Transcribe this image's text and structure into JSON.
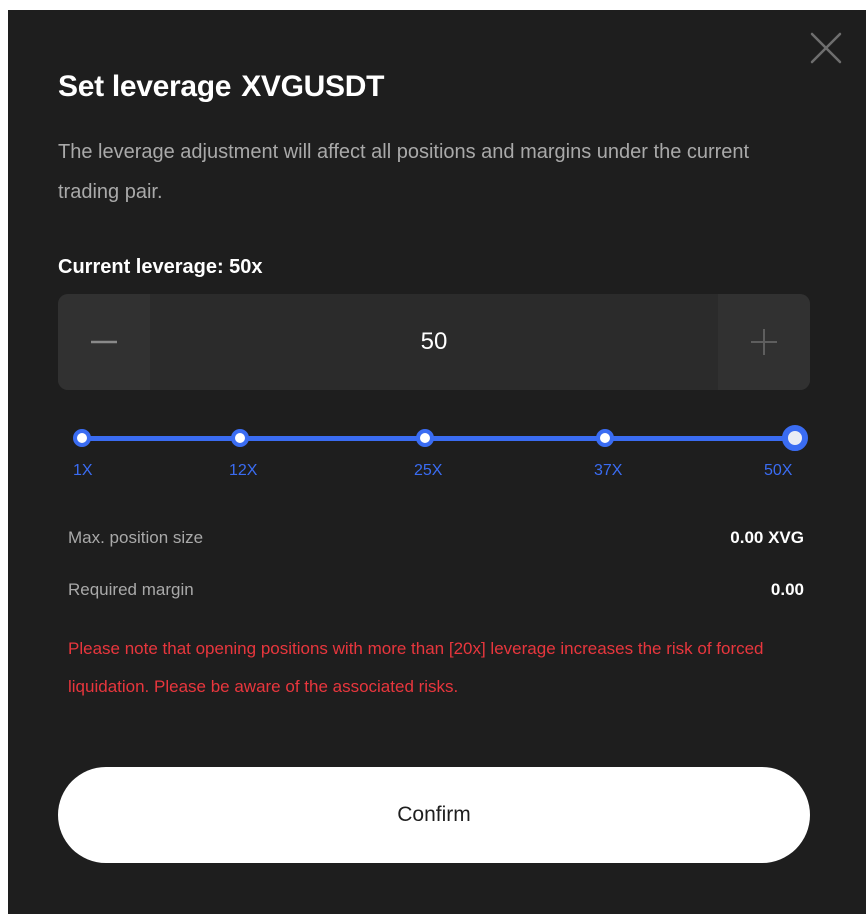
{
  "dialog": {
    "title": "Set leverage",
    "pair": "XVGUSDT",
    "description": "The leverage adjustment will affect all positions and margins under the current trading pair.",
    "current_leverage_label": "Current leverage: 50x"
  },
  "stepper": {
    "value": "50"
  },
  "slider": {
    "min": 1,
    "max": 50,
    "value": 50,
    "marks": [
      "1X",
      "12X",
      "25X",
      "37X",
      "50X"
    ],
    "accent_color": "#3a6cf2"
  },
  "info": {
    "max_position_label": "Max. position size",
    "max_position_value": "0.00 XVG",
    "required_margin_label": "Required margin",
    "required_margin_value": "0.00"
  },
  "warning": {
    "text": "Please note that opening positions with more than [20x] leverage increases the risk of forced liquidation. Please be aware of the associated risks.",
    "color": "#e8363d"
  },
  "actions": {
    "confirm_label": "Confirm"
  },
  "icons": {
    "close": "close-icon",
    "minus": "minus-icon",
    "plus": "plus-icon"
  }
}
